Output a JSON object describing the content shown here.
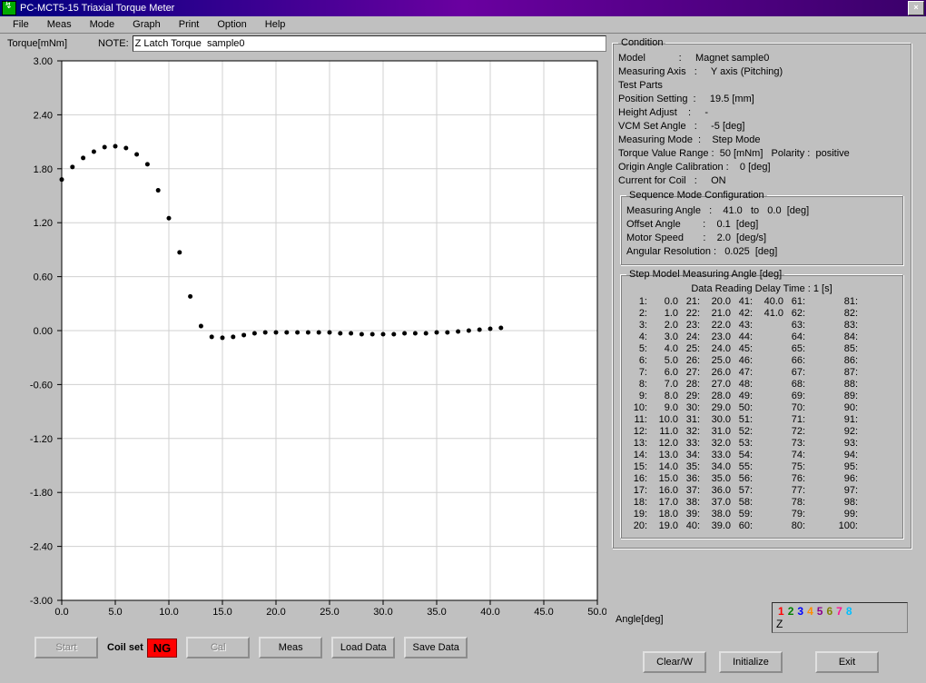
{
  "window": {
    "title": "PC-MCT5-15   Triaxial Torque Meter"
  },
  "menu": [
    "File",
    "Meas",
    "Mode",
    "Graph",
    "Print",
    "Option",
    "Help"
  ],
  "note": {
    "label_left": "Torque[mNm]",
    "label_note": "NOTE:",
    "value": "Z Latch Torque  sample0"
  },
  "chart_data": {
    "type": "scatter",
    "title": "",
    "xlabel": "Angle[deg]",
    "ylabel": "Torque[mNm]",
    "xlim": [
      0,
      50
    ],
    "ylim": [
      -3.0,
      3.0
    ],
    "xticks": [
      0.0,
      5.0,
      10.0,
      15.0,
      20.0,
      25.0,
      30.0,
      35.0,
      40.0,
      45.0,
      50.0
    ],
    "yticks": [
      -3.0,
      -2.4,
      -1.8,
      -1.2,
      -0.6,
      0.0,
      0.6,
      1.2,
      1.8,
      2.4,
      3.0
    ],
    "series": [
      {
        "name": "Z",
        "color": "#000000",
        "points": [
          [
            0.0,
            1.68
          ],
          [
            1.0,
            1.82
          ],
          [
            2.0,
            1.92
          ],
          [
            3.0,
            1.99
          ],
          [
            4.0,
            2.04
          ],
          [
            5.0,
            2.05
          ],
          [
            6.0,
            2.03
          ],
          [
            7.0,
            1.96
          ],
          [
            8.0,
            1.85
          ],
          [
            9.0,
            1.56
          ],
          [
            10.0,
            1.25
          ],
          [
            11.0,
            0.87
          ],
          [
            12.0,
            0.38
          ],
          [
            13.0,
            0.05
          ],
          [
            14.0,
            -0.07
          ],
          [
            15.0,
            -0.08
          ],
          [
            16.0,
            -0.07
          ],
          [
            17.0,
            -0.05
          ],
          [
            18.0,
            -0.03
          ],
          [
            19.0,
            -0.02
          ],
          [
            20.0,
            -0.02
          ],
          [
            21.0,
            -0.02
          ],
          [
            22.0,
            -0.02
          ],
          [
            23.0,
            -0.02
          ],
          [
            24.0,
            -0.02
          ],
          [
            25.0,
            -0.02
          ],
          [
            26.0,
            -0.03
          ],
          [
            27.0,
            -0.03
          ],
          [
            28.0,
            -0.04
          ],
          [
            29.0,
            -0.04
          ],
          [
            30.0,
            -0.04
          ],
          [
            31.0,
            -0.04
          ],
          [
            32.0,
            -0.03
          ],
          [
            33.0,
            -0.03
          ],
          [
            34.0,
            -0.03
          ],
          [
            35.0,
            -0.02
          ],
          [
            36.0,
            -0.02
          ],
          [
            37.0,
            -0.01
          ],
          [
            38.0,
            0.0
          ],
          [
            39.0,
            0.01
          ],
          [
            40.0,
            0.02
          ],
          [
            41.0,
            0.03
          ]
        ]
      }
    ]
  },
  "buttons": {
    "start": "Start",
    "coil_set": "Coil set",
    "coil_status": "NG",
    "cal": "Cal",
    "meas": "Meas",
    "load": "Load Data",
    "save": "Save Data",
    "clear": "Clear/W",
    "init": "Initialize",
    "exit": "Exit"
  },
  "condition": {
    "legend": "Condition",
    "model": "Magnet sample0",
    "axis": "Y axis (Pitching)",
    "test_parts": "",
    "position_setting": "19.5 [mm]",
    "height_adjust": "-",
    "vcm_set_angle": "-5 [deg]",
    "measuring_mode": "Step Mode",
    "torque_range": "50 [mNm]",
    "polarity": "positive",
    "origin_cal": "0 [deg]",
    "current_coil": "ON"
  },
  "sequence": {
    "legend": "Sequence Mode Configuration",
    "measuring_angle": "41.0   to   0.0  [deg]",
    "offset_angle": "0.1  [deg]",
    "motor_speed": "2.0  [deg/s]",
    "angular_resolution": "0.025  [deg]"
  },
  "step_model": {
    "legend": "Step Model Measuring Angle  [deg]",
    "delay_label": "Data Reading Delay Time :  1 [s]",
    "rows": [
      {
        "i": 1,
        "v": "0.0"
      },
      {
        "i": 2,
        "v": "1.0"
      },
      {
        "i": 3,
        "v": "2.0"
      },
      {
        "i": 4,
        "v": "3.0"
      },
      {
        "i": 5,
        "v": "4.0"
      },
      {
        "i": 6,
        "v": "5.0"
      },
      {
        "i": 7,
        "v": "6.0"
      },
      {
        "i": 8,
        "v": "7.0"
      },
      {
        "i": 9,
        "v": "8.0"
      },
      {
        "i": 10,
        "v": "9.0"
      },
      {
        "i": 11,
        "v": "10.0"
      },
      {
        "i": 12,
        "v": "11.0"
      },
      {
        "i": 13,
        "v": "12.0"
      },
      {
        "i": 14,
        "v": "13.0"
      },
      {
        "i": 15,
        "v": "14.0"
      },
      {
        "i": 16,
        "v": "15.0"
      },
      {
        "i": 17,
        "v": "16.0"
      },
      {
        "i": 18,
        "v": "17.0"
      },
      {
        "i": 19,
        "v": "18.0"
      },
      {
        "i": 20,
        "v": "19.0"
      },
      {
        "i": 21,
        "v": "20.0"
      },
      {
        "i": 22,
        "v": "21.0"
      },
      {
        "i": 23,
        "v": "22.0"
      },
      {
        "i": 24,
        "v": "23.0"
      },
      {
        "i": 25,
        "v": "24.0"
      },
      {
        "i": 26,
        "v": "25.0"
      },
      {
        "i": 27,
        "v": "26.0"
      },
      {
        "i": 28,
        "v": "27.0"
      },
      {
        "i": 29,
        "v": "28.0"
      },
      {
        "i": 30,
        "v": "29.0"
      },
      {
        "i": 31,
        "v": "30.0"
      },
      {
        "i": 32,
        "v": "31.0"
      },
      {
        "i": 33,
        "v": "32.0"
      },
      {
        "i": 34,
        "v": "33.0"
      },
      {
        "i": 35,
        "v": "34.0"
      },
      {
        "i": 36,
        "v": "35.0"
      },
      {
        "i": 37,
        "v": "36.0"
      },
      {
        "i": 38,
        "v": "37.0"
      },
      {
        "i": 39,
        "v": "38.0"
      },
      {
        "i": 40,
        "v": "39.0"
      },
      {
        "i": 41,
        "v": "40.0"
      },
      {
        "i": 42,
        "v": "41.0"
      },
      {
        "i": 43,
        "v": ""
      },
      {
        "i": 44,
        "v": ""
      },
      {
        "i": 45,
        "v": ""
      },
      {
        "i": 46,
        "v": ""
      },
      {
        "i": 47,
        "v": ""
      },
      {
        "i": 48,
        "v": ""
      },
      {
        "i": 49,
        "v": ""
      },
      {
        "i": 50,
        "v": ""
      },
      {
        "i": 51,
        "v": ""
      },
      {
        "i": 52,
        "v": ""
      },
      {
        "i": 53,
        "v": ""
      },
      {
        "i": 54,
        "v": ""
      },
      {
        "i": 55,
        "v": ""
      },
      {
        "i": 56,
        "v": ""
      },
      {
        "i": 57,
        "v": ""
      },
      {
        "i": 58,
        "v": ""
      },
      {
        "i": 59,
        "v": ""
      },
      {
        "i": 60,
        "v": ""
      },
      {
        "i": 61,
        "v": ""
      },
      {
        "i": 62,
        "v": ""
      },
      {
        "i": 63,
        "v": ""
      },
      {
        "i": 64,
        "v": ""
      },
      {
        "i": 65,
        "v": ""
      },
      {
        "i": 66,
        "v": ""
      },
      {
        "i": 67,
        "v": ""
      },
      {
        "i": 68,
        "v": ""
      },
      {
        "i": 69,
        "v": ""
      },
      {
        "i": 70,
        "v": ""
      },
      {
        "i": 71,
        "v": ""
      },
      {
        "i": 72,
        "v": ""
      },
      {
        "i": 73,
        "v": ""
      },
      {
        "i": 74,
        "v": ""
      },
      {
        "i": 75,
        "v": ""
      },
      {
        "i": 76,
        "v": ""
      },
      {
        "i": 77,
        "v": ""
      },
      {
        "i": 78,
        "v": ""
      },
      {
        "i": 79,
        "v": ""
      },
      {
        "i": 80,
        "v": ""
      },
      {
        "i": 81,
        "v": ""
      },
      {
        "i": 82,
        "v": ""
      },
      {
        "i": 83,
        "v": ""
      },
      {
        "i": 84,
        "v": ""
      },
      {
        "i": 85,
        "v": ""
      },
      {
        "i": 86,
        "v": ""
      },
      {
        "i": 87,
        "v": ""
      },
      {
        "i": 88,
        "v": ""
      },
      {
        "i": 89,
        "v": ""
      },
      {
        "i": 90,
        "v": ""
      },
      {
        "i": 91,
        "v": ""
      },
      {
        "i": 92,
        "v": ""
      },
      {
        "i": 93,
        "v": ""
      },
      {
        "i": 94,
        "v": ""
      },
      {
        "i": 95,
        "v": ""
      },
      {
        "i": 96,
        "v": ""
      },
      {
        "i": 97,
        "v": ""
      },
      {
        "i": 98,
        "v": ""
      },
      {
        "i": 99,
        "v": ""
      },
      {
        "i": 100,
        "v": ""
      }
    ]
  },
  "legend_box": {
    "colors": [
      "#ff0000",
      "#008000",
      "#0000ff",
      "#ff8c00",
      "#8b008b",
      "#808000",
      "#ff1493",
      "#00bfff"
    ],
    "numbers": [
      "1",
      "2",
      "3",
      "4",
      "5",
      "6",
      "7",
      "8"
    ],
    "label": "Z"
  },
  "angle_label": "Angle[deg]"
}
